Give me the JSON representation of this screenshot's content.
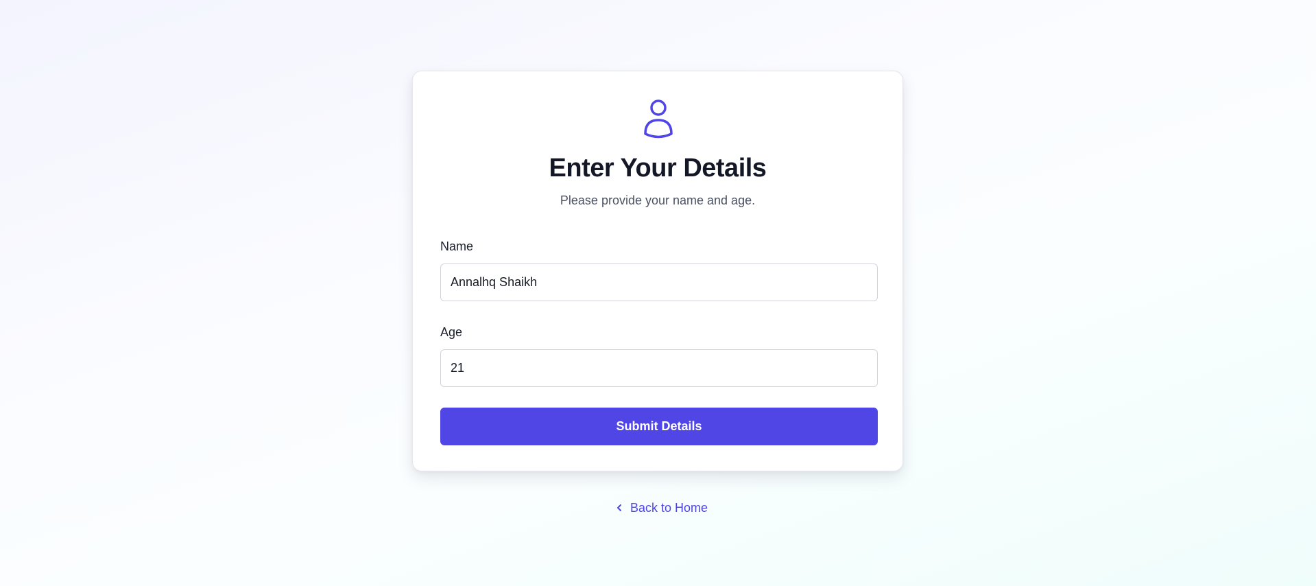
{
  "form": {
    "icon": "user-icon",
    "title": "Enter Your Details",
    "subtitle": "Please provide your name and age.",
    "name_label": "Name",
    "name_value": "Annalhq Shaikh",
    "age_label": "Age",
    "age_value": "21",
    "submit_label": "Submit Details"
  },
  "footer": {
    "back_icon": "chevron-left-icon",
    "back_label": "Back to Home"
  },
  "colors": {
    "accent": "#4f46e5",
    "title": "#141826",
    "subtitle": "#4b5262"
  }
}
